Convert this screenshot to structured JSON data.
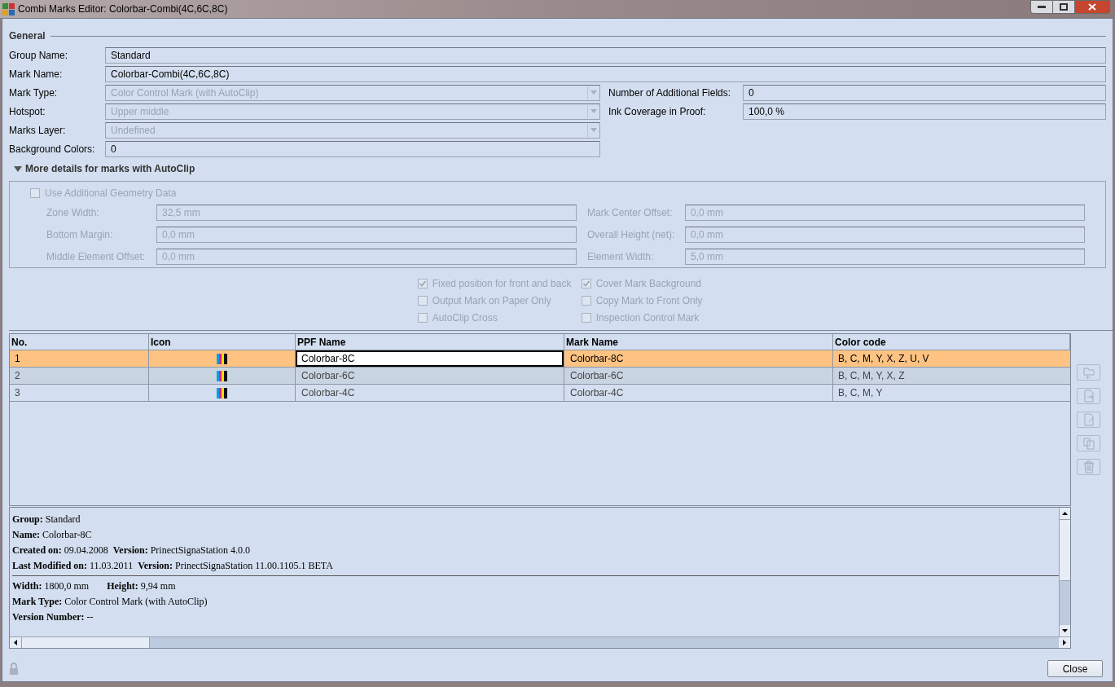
{
  "window": {
    "title": "Combi Marks Editor: Colorbar-Combi(4C,6C,8C)"
  },
  "general": {
    "heading": "General",
    "wide_fields": [
      {
        "label": "Group Name:",
        "value": "Standard",
        "disabled": false
      },
      {
        "label": "Mark Name:",
        "value": "Colorbar-Combi(4C,6C,8C)",
        "disabled": false
      }
    ],
    "left_fields": [
      {
        "label": "Mark Type:",
        "value": "Color Control Mark (with AutoClip)",
        "kind": "combo",
        "disabled": true
      },
      {
        "label": "Hotspot:",
        "value": "Upper middle",
        "kind": "combo",
        "disabled": true
      },
      {
        "label": "Marks Layer:",
        "value": "Undefined",
        "kind": "combo",
        "disabled": true
      },
      {
        "label": "Background Colors:",
        "value": "0",
        "kind": "text",
        "disabled": false
      }
    ],
    "right_fields": [
      {
        "label": "Number of Additional Fields:",
        "value": "0",
        "disabled": false
      },
      {
        "label": "Ink Coverage in Proof:",
        "value": "100,0 %",
        "disabled": false
      }
    ]
  },
  "autoclip": {
    "title": "More details for marks with AutoClip",
    "expanded": true,
    "geometry_checkbox": {
      "label": "Use Additional Geometry Data",
      "checked": false,
      "disabled": true
    },
    "left_fields": [
      {
        "label": "Zone Width:",
        "value": "32,5 mm",
        "disabled": true
      },
      {
        "label": "Bottom Margin:",
        "value": "0,0 mm",
        "disabled": true
      },
      {
        "label": "Middle Element Offset:",
        "value": "0,0 mm",
        "disabled": true
      }
    ],
    "right_fields": [
      {
        "label": "Mark Center Offset:",
        "value": "0,0 mm",
        "disabled": true
      },
      {
        "label": "Overall Height (net):",
        "value": "0,0 mm",
        "disabled": true
      },
      {
        "label": "Element Width:",
        "value": "5,0 mm",
        "disabled": true
      }
    ]
  },
  "options": [
    {
      "label": "Fixed position for front and back",
      "checked": true,
      "disabled": true
    },
    {
      "label": "Cover Mark Background",
      "checked": true,
      "disabled": true
    },
    {
      "label": "Output Mark on Paper Only",
      "checked": false,
      "disabled": true
    },
    {
      "label": "Copy Mark to Front Only",
      "checked": false,
      "disabled": true
    },
    {
      "label": "AutoClip Cross",
      "checked": false,
      "disabled": true
    },
    {
      "label": "Inspection Control Mark",
      "checked": false,
      "disabled": true
    }
  ],
  "table": {
    "columns": [
      "No.",
      "Icon",
      "PPF Name",
      "Mark Name",
      "Color code"
    ],
    "rows": [
      {
        "no": "1",
        "ppf_name": "Colorbar-8C",
        "mark_name": "Colorbar-8C",
        "color_code": "B, C, M, Y, X, Z, U, V",
        "selected": true,
        "editing": true
      },
      {
        "no": "2",
        "ppf_name": "Colorbar-6C",
        "mark_name": "Colorbar-6C",
        "color_code": "B, C, M, Y, X, Z",
        "selected": false,
        "editing": false
      },
      {
        "no": "3",
        "ppf_name": "Colorbar-4C",
        "mark_name": "Colorbar-4C",
        "color_code": "B, C, M, Y",
        "selected": false,
        "editing": false
      }
    ]
  },
  "side_buttons": [
    {
      "kind": "replace",
      "disabled": true
    },
    {
      "kind": "import",
      "disabled": true
    },
    {
      "kind": "edit",
      "disabled": true
    },
    {
      "kind": "copy",
      "disabled": true
    },
    {
      "kind": "delete",
      "disabled": true
    }
  ],
  "info": {
    "top_lines": [
      "**Group:** Standard",
      "**Name:** Colorbar-8C",
      "**Created on:** 09.04.2008  **Version:** PrinectSignaStation 4.0.0",
      "**Last Modified on:** 11.03.2011  **Version:** PrinectSignaStation 11.00.1105.1 BETA"
    ],
    "size_line": [
      "**Width:** 1800,0 mm",
      "**Height:** 9,94 mm"
    ],
    "bottom_lines": [
      "**Mark Type:** Color Control Mark (with AutoClip)",
      "**Version Number:** --"
    ]
  },
  "close_button": "Close"
}
